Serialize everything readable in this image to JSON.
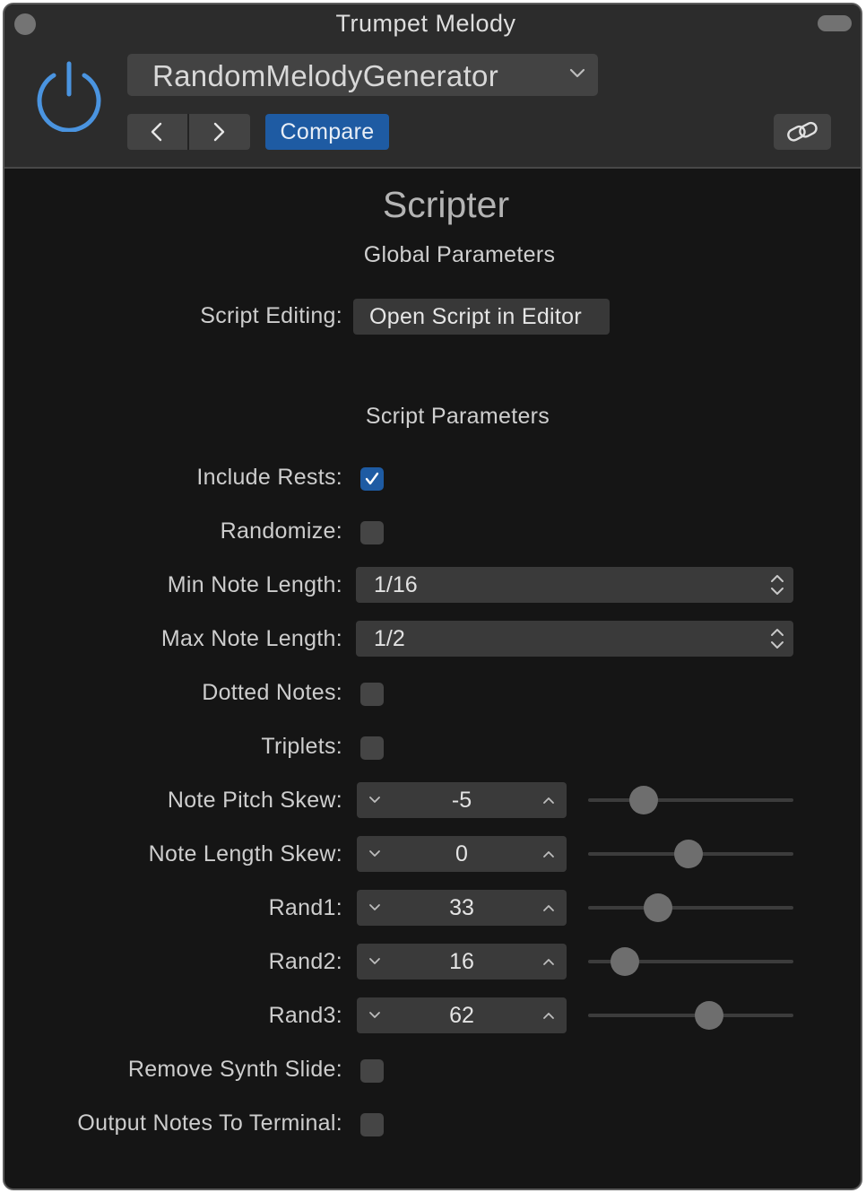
{
  "window": {
    "title": "Trumpet Melody",
    "accent_color": "#1e5ba3",
    "power_color": "#4a94e0"
  },
  "header": {
    "preset_name": "RandomMelodyGenerator",
    "compare_label": "Compare",
    "icons": [
      "power-icon",
      "chevron-down-icon",
      "chevron-left-icon",
      "chevron-right-icon",
      "link-icon"
    ]
  },
  "plugin": {
    "name": "Scripter"
  },
  "global": {
    "heading": "Global Parameters",
    "script_editing_label": "Script Editing:",
    "open_script_button": "Open Script in Editor"
  },
  "script": {
    "heading": "Script Parameters",
    "include_rests": {
      "label": "Include Rests:",
      "checked": true
    },
    "randomize": {
      "label": "Randomize:",
      "checked": false
    },
    "min_note_length": {
      "label": "Min Note Length:",
      "value": "1/16"
    },
    "max_note_length": {
      "label": "Max Note Length:",
      "value": "1/2"
    },
    "dotted_notes": {
      "label": "Dotted Notes:",
      "checked": false
    },
    "triplets": {
      "label": "Triplets:",
      "checked": false
    },
    "note_pitch_skew": {
      "label": "Note Pitch Skew:",
      "value": "-5",
      "slider_fraction": 0.27
    },
    "note_length_skew": {
      "label": "Note Length Skew:",
      "value": "0",
      "slider_fraction": 0.49
    },
    "rand1": {
      "label": "Rand1:",
      "value": "33",
      "slider_fraction": 0.34
    },
    "rand2": {
      "label": "Rand2:",
      "value": "16",
      "slider_fraction": 0.18
    },
    "rand3": {
      "label": "Rand3:",
      "value": "62",
      "slider_fraction": 0.59
    },
    "remove_synth_slide": {
      "label": "Remove Synth Slide:",
      "checked": false
    },
    "output_notes_to_terminal": {
      "label": "Output Notes To Terminal:",
      "checked": false
    }
  }
}
